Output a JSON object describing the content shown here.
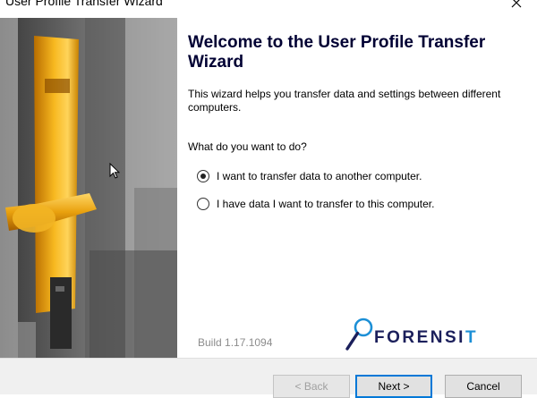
{
  "window": {
    "title": "User Profile Transfer Wizard",
    "close_icon": "close-icon"
  },
  "content": {
    "heading": "Welcome to the User Profile Transfer Wizard",
    "intro": "This wizard helps you transfer data and settings between different computers.",
    "question": "What do you want to do?",
    "options": [
      {
        "label": "I want to transfer data to another computer.",
        "selected": true
      },
      {
        "label": "I have data I want to transfer to this computer.",
        "selected": false
      }
    ],
    "build": "Build 1.17.1094",
    "logo": {
      "prefix": "FORENSI",
      "suffix": "T",
      "icon": "magnifier-icon"
    }
  },
  "footer": {
    "back_label": "< Back",
    "next_label": "Next >",
    "cancel_label": "Cancel"
  },
  "colors": {
    "heading": "#000033",
    "accent": "#0078d7",
    "logo_dark": "#1b1f5b",
    "logo_blue": "#1c8fd6"
  }
}
